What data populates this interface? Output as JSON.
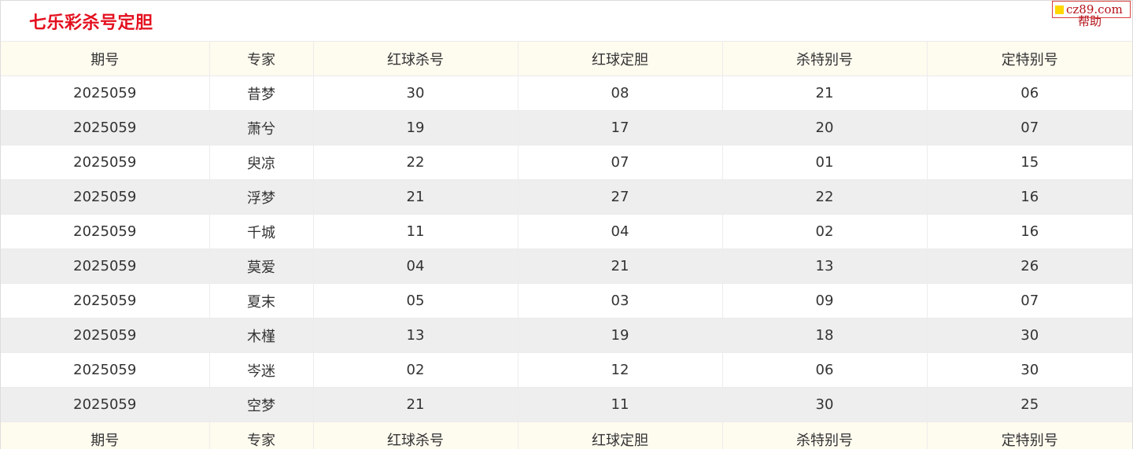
{
  "header": {
    "title": "七乐彩杀号定胆",
    "brand": "cz89.com",
    "help": "帮助"
  },
  "columns": [
    "期号",
    "专家",
    "红球杀号",
    "红球定胆",
    "杀特别号",
    "定特别号"
  ],
  "rows": [
    [
      "2025059",
      "昔梦",
      "30",
      "08",
      "21",
      "06"
    ],
    [
      "2025059",
      "萧兮",
      "19",
      "17",
      "20",
      "07"
    ],
    [
      "2025059",
      "臾凉",
      "22",
      "07",
      "01",
      "15"
    ],
    [
      "2025059",
      "浮梦",
      "21",
      "27",
      "22",
      "16"
    ],
    [
      "2025059",
      "千城",
      "11",
      "04",
      "02",
      "16"
    ],
    [
      "2025059",
      "莫爱",
      "04",
      "21",
      "13",
      "26"
    ],
    [
      "2025059",
      "夏末",
      "05",
      "03",
      "09",
      "07"
    ],
    [
      "2025059",
      "木槿",
      "13",
      "19",
      "18",
      "30"
    ],
    [
      "2025059",
      "岑迷",
      "02",
      "12",
      "06",
      "30"
    ],
    [
      "2025059",
      "空梦",
      "21",
      "11",
      "30",
      "25"
    ]
  ],
  "colors": {
    "title": "#e4101f",
    "header_bg": "#fefbef",
    "alt_row_bg": "#eeeeee",
    "brand_square": "#ffd800"
  }
}
